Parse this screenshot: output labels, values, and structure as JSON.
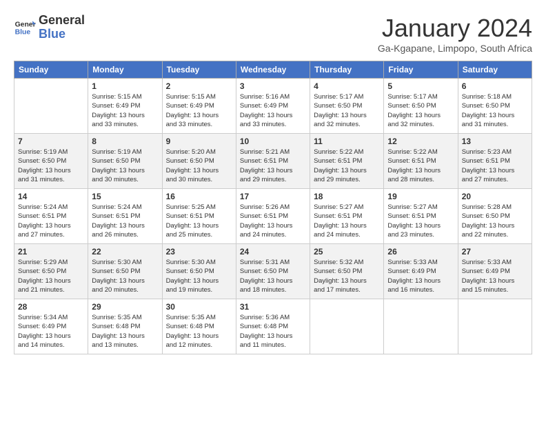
{
  "header": {
    "logo_line1": "General",
    "logo_line2": "Blue",
    "month": "January 2024",
    "location": "Ga-Kgapane, Limpopo, South Africa"
  },
  "days_of_week": [
    "Sunday",
    "Monday",
    "Tuesday",
    "Wednesday",
    "Thursday",
    "Friday",
    "Saturday"
  ],
  "weeks": [
    [
      {
        "day": "",
        "info": ""
      },
      {
        "day": "1",
        "info": "Sunrise: 5:15 AM\nSunset: 6:49 PM\nDaylight: 13 hours\nand 33 minutes."
      },
      {
        "day": "2",
        "info": "Sunrise: 5:15 AM\nSunset: 6:49 PM\nDaylight: 13 hours\nand 33 minutes."
      },
      {
        "day": "3",
        "info": "Sunrise: 5:16 AM\nSunset: 6:49 PM\nDaylight: 13 hours\nand 33 minutes."
      },
      {
        "day": "4",
        "info": "Sunrise: 5:17 AM\nSunset: 6:50 PM\nDaylight: 13 hours\nand 32 minutes."
      },
      {
        "day": "5",
        "info": "Sunrise: 5:17 AM\nSunset: 6:50 PM\nDaylight: 13 hours\nand 32 minutes."
      },
      {
        "day": "6",
        "info": "Sunrise: 5:18 AM\nSunset: 6:50 PM\nDaylight: 13 hours\nand 31 minutes."
      }
    ],
    [
      {
        "day": "7",
        "info": "Sunrise: 5:19 AM\nSunset: 6:50 PM\nDaylight: 13 hours\nand 31 minutes."
      },
      {
        "day": "8",
        "info": "Sunrise: 5:19 AM\nSunset: 6:50 PM\nDaylight: 13 hours\nand 30 minutes."
      },
      {
        "day": "9",
        "info": "Sunrise: 5:20 AM\nSunset: 6:50 PM\nDaylight: 13 hours\nand 30 minutes."
      },
      {
        "day": "10",
        "info": "Sunrise: 5:21 AM\nSunset: 6:51 PM\nDaylight: 13 hours\nand 29 minutes."
      },
      {
        "day": "11",
        "info": "Sunrise: 5:22 AM\nSunset: 6:51 PM\nDaylight: 13 hours\nand 29 minutes."
      },
      {
        "day": "12",
        "info": "Sunrise: 5:22 AM\nSunset: 6:51 PM\nDaylight: 13 hours\nand 28 minutes."
      },
      {
        "day": "13",
        "info": "Sunrise: 5:23 AM\nSunset: 6:51 PM\nDaylight: 13 hours\nand 27 minutes."
      }
    ],
    [
      {
        "day": "14",
        "info": "Sunrise: 5:24 AM\nSunset: 6:51 PM\nDaylight: 13 hours\nand 27 minutes."
      },
      {
        "day": "15",
        "info": "Sunrise: 5:24 AM\nSunset: 6:51 PM\nDaylight: 13 hours\nand 26 minutes."
      },
      {
        "day": "16",
        "info": "Sunrise: 5:25 AM\nSunset: 6:51 PM\nDaylight: 13 hours\nand 25 minutes."
      },
      {
        "day": "17",
        "info": "Sunrise: 5:26 AM\nSunset: 6:51 PM\nDaylight: 13 hours\nand 24 minutes."
      },
      {
        "day": "18",
        "info": "Sunrise: 5:27 AM\nSunset: 6:51 PM\nDaylight: 13 hours\nand 24 minutes."
      },
      {
        "day": "19",
        "info": "Sunrise: 5:27 AM\nSunset: 6:51 PM\nDaylight: 13 hours\nand 23 minutes."
      },
      {
        "day": "20",
        "info": "Sunrise: 5:28 AM\nSunset: 6:50 PM\nDaylight: 13 hours\nand 22 minutes."
      }
    ],
    [
      {
        "day": "21",
        "info": "Sunrise: 5:29 AM\nSunset: 6:50 PM\nDaylight: 13 hours\nand 21 minutes."
      },
      {
        "day": "22",
        "info": "Sunrise: 5:30 AM\nSunset: 6:50 PM\nDaylight: 13 hours\nand 20 minutes."
      },
      {
        "day": "23",
        "info": "Sunrise: 5:30 AM\nSunset: 6:50 PM\nDaylight: 13 hours\nand 19 minutes."
      },
      {
        "day": "24",
        "info": "Sunrise: 5:31 AM\nSunset: 6:50 PM\nDaylight: 13 hours\nand 18 minutes."
      },
      {
        "day": "25",
        "info": "Sunrise: 5:32 AM\nSunset: 6:50 PM\nDaylight: 13 hours\nand 17 minutes."
      },
      {
        "day": "26",
        "info": "Sunrise: 5:33 AM\nSunset: 6:49 PM\nDaylight: 13 hours\nand 16 minutes."
      },
      {
        "day": "27",
        "info": "Sunrise: 5:33 AM\nSunset: 6:49 PM\nDaylight: 13 hours\nand 15 minutes."
      }
    ],
    [
      {
        "day": "28",
        "info": "Sunrise: 5:34 AM\nSunset: 6:49 PM\nDaylight: 13 hours\nand 14 minutes."
      },
      {
        "day": "29",
        "info": "Sunrise: 5:35 AM\nSunset: 6:48 PM\nDaylight: 13 hours\nand 13 minutes."
      },
      {
        "day": "30",
        "info": "Sunrise: 5:35 AM\nSunset: 6:48 PM\nDaylight: 13 hours\nand 12 minutes."
      },
      {
        "day": "31",
        "info": "Sunrise: 5:36 AM\nSunset: 6:48 PM\nDaylight: 13 hours\nand 11 minutes."
      },
      {
        "day": "",
        "info": ""
      },
      {
        "day": "",
        "info": ""
      },
      {
        "day": "",
        "info": ""
      }
    ]
  ]
}
